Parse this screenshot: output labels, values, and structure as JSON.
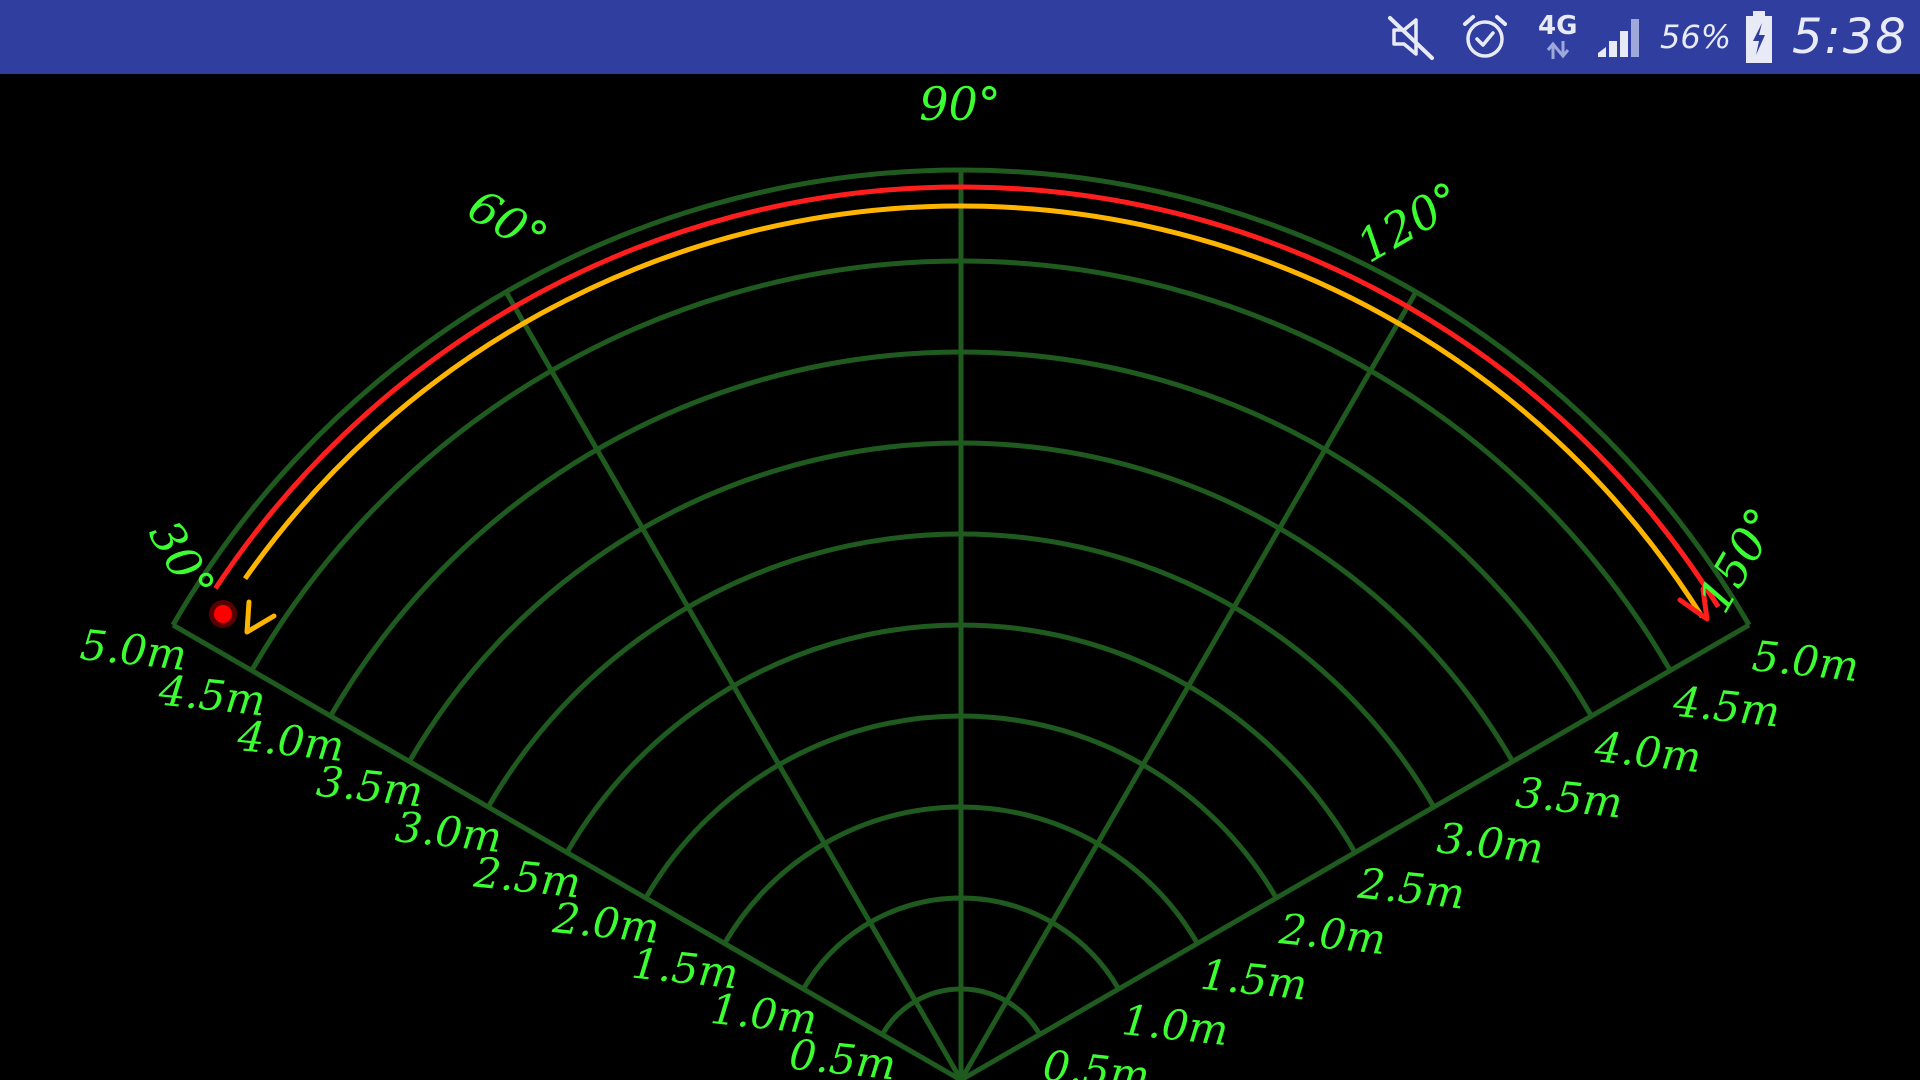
{
  "status_bar": {
    "network_type": "4G",
    "battery_percent": "56%",
    "time": "5:38",
    "icons": [
      "mute-icon",
      "alarm-icon",
      "data-arrows-icon",
      "signal-icon",
      "battery-charging-icon"
    ],
    "background_color": "#303f9f"
  },
  "radar": {
    "angle_labels": [
      "30°",
      "60°",
      "90°",
      "120°",
      "150°"
    ],
    "distance_labels": [
      "0.5m",
      "1.0m",
      "1.5m",
      "2.0m",
      "2.5m",
      "3.0m",
      "3.5m",
      "4.0m",
      "4.5m",
      "5.0m"
    ],
    "grid_color": "#1f5a1f",
    "label_color": "#3cff32",
    "sweep_colors": {
      "outer": "#ff1e1e",
      "inner": "#ffb400"
    },
    "target_indicator_color": "#ff0000"
  }
}
